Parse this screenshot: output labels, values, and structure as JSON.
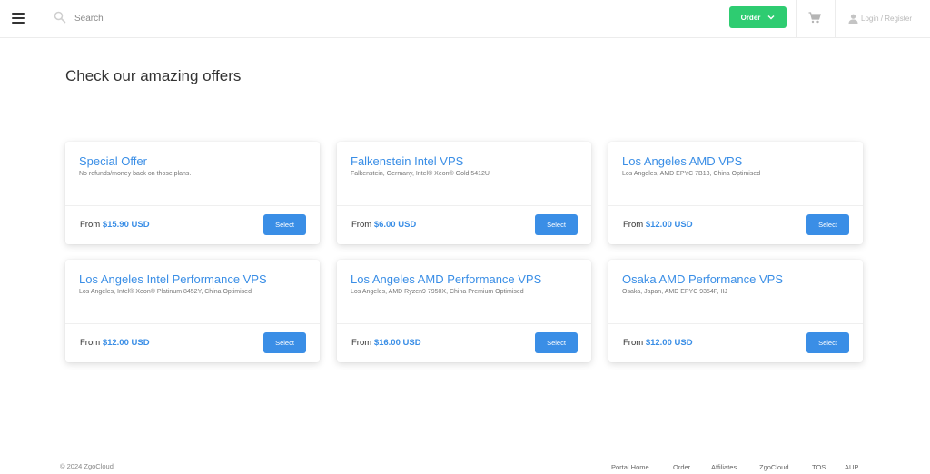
{
  "header": {
    "search_placeholder": "Search",
    "order_label": "Order",
    "login_label": "Login / Register"
  },
  "main": {
    "title": "Check our amazing offers",
    "from_label": "From",
    "select_label": "Select",
    "products": [
      {
        "name": "Special Offer",
        "description": "No refunds/money back on those plans.",
        "price": "$15.90 USD"
      },
      {
        "name": "Falkenstein Intel VPS",
        "description": "Falkenstein, Germany, Intel® Xeon® Gold 5412U",
        "price": "$6.00 USD"
      },
      {
        "name": "Los Angeles AMD VPS",
        "description": "Los Angeles, AMD EPYC 7B13, China Optimised",
        "price": "$12.00 USD"
      },
      {
        "name": "Los Angeles Intel Performance VPS",
        "description": "Los Angeles, Intel® Xeon® Platinum 8452Y, China Optimised",
        "price": "$12.00 USD"
      },
      {
        "name": "Los Angeles AMD Performance VPS",
        "description": "Los Angeles, AMD Ryzen9 7950X, China Premium Optimised",
        "price": "$16.00 USD"
      },
      {
        "name": "Osaka AMD Performance VPS",
        "description": "Osaka, Japan, AMD EPYC 9354P, IIJ",
        "price": "$12.00 USD"
      }
    ]
  },
  "footer": {
    "copyright": "© 2024 ZgoCloud",
    "links": [
      "Portal Home",
      "Order",
      "Affiliates",
      "ZgoCloud",
      "TOS",
      "AUP"
    ]
  },
  "colors": {
    "accent": "#3a8ee6",
    "order_button": "#2ecc71"
  },
  "icons": [
    "menu-icon",
    "search-icon",
    "chevron-down-icon",
    "cart-icon",
    "user-icon"
  ]
}
